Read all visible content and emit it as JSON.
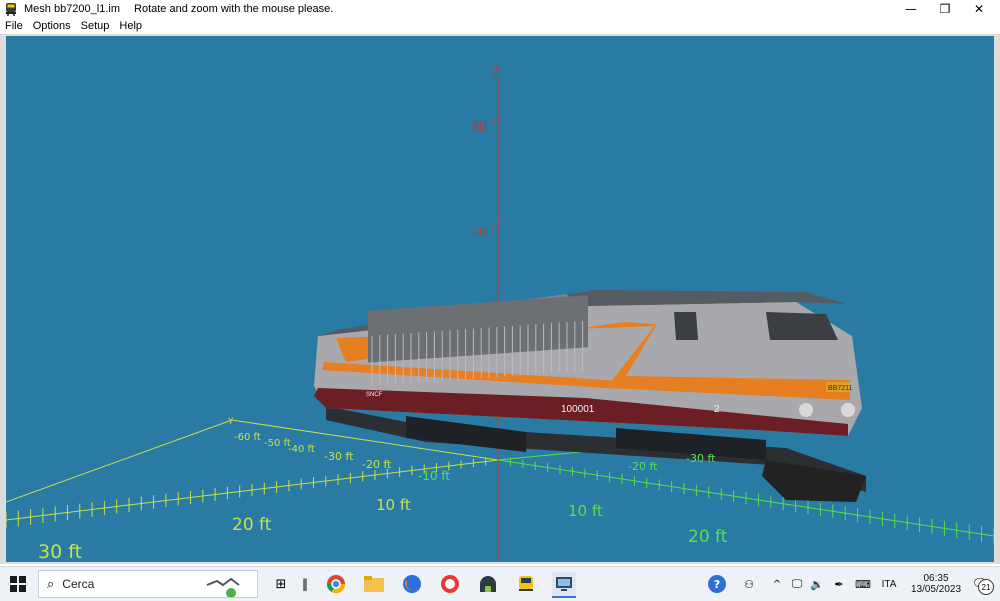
{
  "window": {
    "title": "Mesh bb7200_l1.im",
    "hint": "Rotate and zoom with the mouse please.",
    "controls": {
      "minimize": "—",
      "restore": "❐",
      "close": "✕"
    }
  },
  "menu": [
    {
      "label": "File"
    },
    {
      "label": "Options"
    },
    {
      "label": "Setup"
    },
    {
      "label": "Help"
    }
  ],
  "viewport": {
    "background": "#2a7ba3",
    "axis_z_label": "Z",
    "axis_y_label": "Y",
    "z_ticks": [
      "30",
      "20"
    ],
    "left_ticks": [
      "-60 ft",
      "-50 ft",
      "-40 ft",
      "-30 ft",
      "-20 ft",
      "10 ft",
      "20 ft",
      "30 ft"
    ],
    "right_ticks": [
      "-30 ft",
      "-20 ft",
      "-10 ft",
      "10 ft",
      "20 ft"
    ],
    "loco_number": "100001",
    "loco_side_number": "2",
    "loco_badge": "BB7211",
    "loco_logo": "SNCF",
    "colors": {
      "grid": "#c8e04a",
      "grid_right": "#56e04a",
      "axis": "#c0392b",
      "body": "#a9a9ad",
      "orange": "#e67e22",
      "maroon": "#6b1e24",
      "roof": "#555b63"
    }
  },
  "taskbar": {
    "search_placeholder": "Cerca",
    "time": "06:35",
    "date": "13/05/2023",
    "language": "ITA",
    "notifications": "21"
  }
}
